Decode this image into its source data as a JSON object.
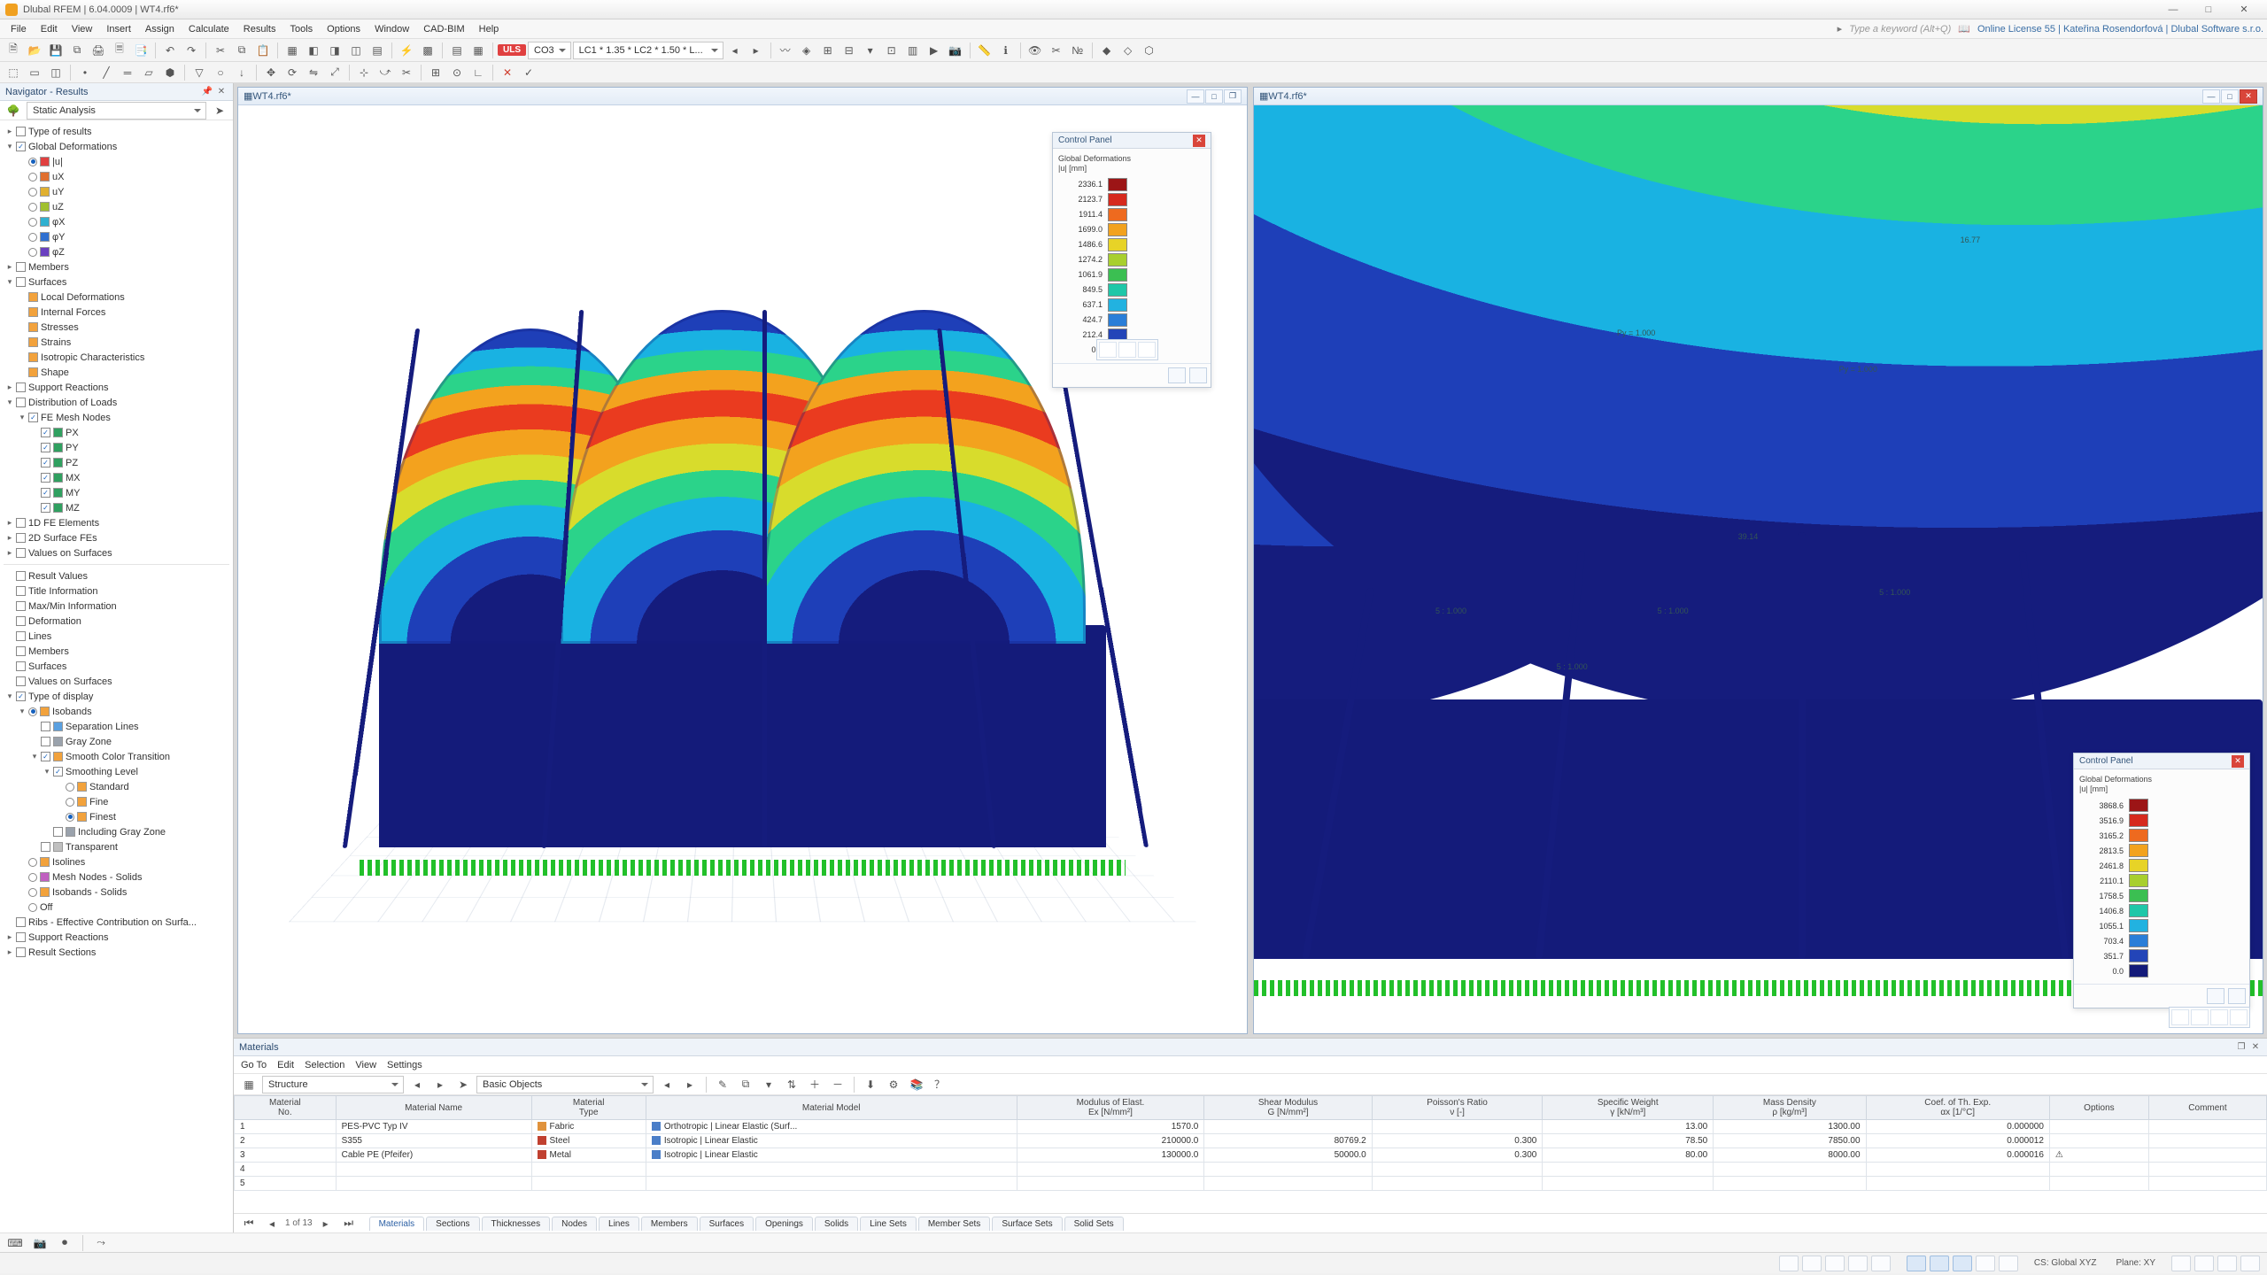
{
  "app": {
    "title": "Dlubal RFEM | 6.04.0009 | WT4.rf6*"
  },
  "window_buttons": {
    "min": "—",
    "max": "□",
    "close": "✕"
  },
  "menubar": {
    "items": [
      "File",
      "Edit",
      "View",
      "Insert",
      "Assign",
      "Calculate",
      "Results",
      "Tools",
      "Options",
      "Window",
      "CAD-BIM",
      "Help"
    ],
    "search_hint": "Type a keyword (Alt+Q)",
    "license": "Online License 55 | Kateřina Rosendorfová | Dlubal Software s.r.o."
  },
  "toolbar1": {
    "uls_label": "ULS",
    "co_label": "CO3",
    "lc_combo": "LC1 * 1.35 * LC2 * 1.50 * L..."
  },
  "navigator": {
    "title": "Navigator - Results",
    "static_combo": "Static Analysis",
    "tree1": [
      {
        "lvl": 0,
        "tw": "▸",
        "chk": false,
        "label": "Type of results"
      },
      {
        "lvl": 0,
        "tw": "▾",
        "chk": true,
        "label": "Global Deformations"
      },
      {
        "lvl": 1,
        "radio": true,
        "on": true,
        "color": "#e04040",
        "label": "|u|"
      },
      {
        "lvl": 1,
        "radio": true,
        "color": "#e07030",
        "label": "uX"
      },
      {
        "lvl": 1,
        "radio": true,
        "color": "#e0b030",
        "label": "uY"
      },
      {
        "lvl": 1,
        "radio": true,
        "color": "#a0c030",
        "label": "uZ"
      },
      {
        "lvl": 1,
        "radio": true,
        "color": "#30b0d0",
        "label": "φX"
      },
      {
        "lvl": 1,
        "radio": true,
        "color": "#3070d0",
        "label": "φY"
      },
      {
        "lvl": 1,
        "radio": true,
        "color": "#6a40c0",
        "label": "φZ"
      },
      {
        "lvl": 0,
        "tw": "▸",
        "chk": false,
        "label": "Members"
      },
      {
        "lvl": 0,
        "tw": "▾",
        "chk": false,
        "label": "Surfaces"
      },
      {
        "lvl": 1,
        "color": "#f2a23c",
        "label": "Local Deformations"
      },
      {
        "lvl": 1,
        "color": "#f2a23c",
        "label": "Internal Forces"
      },
      {
        "lvl": 1,
        "color": "#f2a23c",
        "label": "Stresses"
      },
      {
        "lvl": 1,
        "color": "#f2a23c",
        "label": "Strains"
      },
      {
        "lvl": 1,
        "color": "#f2a23c",
        "label": "Isotropic Characteristics"
      },
      {
        "lvl": 1,
        "color": "#f2a23c",
        "label": "Shape"
      },
      {
        "lvl": 0,
        "tw": "▸",
        "chk": false,
        "label": "Support Reactions"
      },
      {
        "lvl": 0,
        "tw": "▾",
        "chk": false,
        "label": "Distribution of Loads"
      },
      {
        "lvl": 1,
        "tw": "▾",
        "chk": true,
        "label": "FE Mesh Nodes"
      },
      {
        "lvl": 2,
        "chk": true,
        "color": "#30a060",
        "label": "PX"
      },
      {
        "lvl": 2,
        "chk": true,
        "color": "#30a060",
        "label": "PY"
      },
      {
        "lvl": 2,
        "chk": true,
        "color": "#30a060",
        "label": "PZ"
      },
      {
        "lvl": 2,
        "chk": true,
        "color": "#30a060",
        "label": "MX"
      },
      {
        "lvl": 2,
        "chk": true,
        "color": "#30a060",
        "label": "MY"
      },
      {
        "lvl": 2,
        "chk": true,
        "color": "#30a060",
        "label": "MZ"
      },
      {
        "lvl": 0,
        "tw": "▸",
        "chk": false,
        "label": "1D FE Elements"
      },
      {
        "lvl": 0,
        "tw": "▸",
        "chk": false,
        "label": "2D Surface FEs"
      },
      {
        "lvl": 0,
        "tw": "▸",
        "chk": false,
        "label": "Values on Surfaces"
      }
    ],
    "tree2": [
      {
        "lvl": 0,
        "chk": false,
        "label": "Result Values"
      },
      {
        "lvl": 0,
        "chk": false,
        "label": "Title Information"
      },
      {
        "lvl": 0,
        "chk": false,
        "label": "Max/Min Information"
      },
      {
        "lvl": 0,
        "chk": false,
        "label": "Deformation"
      },
      {
        "lvl": 0,
        "chk": false,
        "label": "Lines"
      },
      {
        "lvl": 0,
        "chk": false,
        "label": "Members"
      },
      {
        "lvl": 0,
        "chk": false,
        "label": "Surfaces"
      },
      {
        "lvl": 0,
        "chk": false,
        "label": "Values on Surfaces"
      },
      {
        "lvl": 0,
        "tw": "▾",
        "chk": true,
        "label": "Type of display"
      },
      {
        "lvl": 1,
        "tw": "▾",
        "radio": true,
        "on": true,
        "color": "#f2a23c",
        "label": "Isobands"
      },
      {
        "lvl": 2,
        "chk": false,
        "color": "#5aa0e0",
        "label": "Separation Lines"
      },
      {
        "lvl": 2,
        "chk": false,
        "color": "#9aa2ac",
        "label": "Gray Zone"
      },
      {
        "lvl": 2,
        "tw": "▾",
        "chk": true,
        "color": "#f2a23c",
        "label": "Smooth Color Transition"
      },
      {
        "lvl": 3,
        "tw": "▾",
        "chk": true,
        "label": "Smoothing Level"
      },
      {
        "lvl": 4,
        "radio": true,
        "color": "#f2a23c",
        "label": "Standard"
      },
      {
        "lvl": 4,
        "radio": true,
        "color": "#f2a23c",
        "label": "Fine"
      },
      {
        "lvl": 4,
        "radio": true,
        "on": true,
        "color": "#f2a23c",
        "label": "Finest"
      },
      {
        "lvl": 3,
        "chk": false,
        "color": "#9aa2ac",
        "label": "Including Gray Zone"
      },
      {
        "lvl": 2,
        "chk": false,
        "color": "#c0c0c0",
        "label": "Transparent"
      },
      {
        "lvl": 1,
        "radio": true,
        "color": "#f2a23c",
        "label": "Isolines"
      },
      {
        "lvl": 1,
        "radio": true,
        "color": "#c060c0",
        "label": "Mesh Nodes - Solids"
      },
      {
        "lvl": 1,
        "radio": true,
        "color": "#f2a23c",
        "label": "Isobands - Solids"
      },
      {
        "lvl": 1,
        "radio": true,
        "label": "Off"
      },
      {
        "lvl": 0,
        "chk": false,
        "label": "Ribs - Effective Contribution on Surfa..."
      },
      {
        "lvl": 0,
        "tw": "▸",
        "chk": false,
        "label": "Support Reactions"
      },
      {
        "lvl": 0,
        "tw": "▸",
        "chk": false,
        "label": "Result Sections"
      }
    ]
  },
  "viewports": {
    "left_title": "WT4.rf6*",
    "right_title": "WT4.rf6*",
    "annotations": [
      "5 : 1.000",
      "Py = 1.000",
      "39.14",
      "16.77"
    ]
  },
  "control_panel": {
    "title": "Control Panel",
    "subtitle": "Global Deformations\n|u| [mm]",
    "legend1": {
      "values": [
        "2336.1",
        "2123.7",
        "1911.4",
        "1699.0",
        "1486.6",
        "1274.2",
        "1061.9",
        "849.5",
        "637.1",
        "424.7",
        "212.4",
        "0.0"
      ],
      "colors": [
        "#9c1516",
        "#d62a1e",
        "#ee6a1f",
        "#f2a21e",
        "#e7d327",
        "#a8cf2e",
        "#3bbf52",
        "#1fc7a8",
        "#22b2e0",
        "#2a7ed8",
        "#2345b8",
        "#141b7a"
      ]
    },
    "legend2": {
      "values": [
        "3868.6",
        "3516.9",
        "3165.2",
        "2813.5",
        "2461.8",
        "2110.1",
        "1758.5",
        "1406.8",
        "1055.1",
        "703.4",
        "351.7",
        "0.0"
      ],
      "colors": [
        "#9c1516",
        "#d62a1e",
        "#ee6a1f",
        "#f2a21e",
        "#e7d327",
        "#a8cf2e",
        "#3bbf52",
        "#1fc7a8",
        "#22b2e0",
        "#2a7ed8",
        "#2345b8",
        "#141b7a"
      ]
    }
  },
  "materials": {
    "title": "Materials",
    "menu": [
      "Go To",
      "Edit",
      "Selection",
      "View",
      "Settings"
    ],
    "structure_combo": "Structure",
    "objects_combo": "Basic Objects",
    "headers": [
      "Material\nNo.",
      "Material Name",
      "Material\nType",
      "Material Model",
      "Modulus of Elast.\nEx [N/mm²]",
      "Shear Modulus\nG [N/mm²]",
      "Poisson's Ratio\nν [-]",
      "Specific Weight\nγ [kN/m³]",
      "Mass Density\nρ [kg/m³]",
      "Coef. of Th. Exp.\nαx [1/°C]",
      "Options",
      "Comment"
    ],
    "rows": [
      {
        "no": "1",
        "name": "PES-PVC Typ IV",
        "type": "Fabric",
        "tcolor": "#e0923c",
        "model": "Orthotropic | Linear Elastic (Surf...",
        "mcolor": "#4a7ec8",
        "E": "1570.0",
        "G": "",
        "nu": "",
        "gamma": "13.00",
        "rho": "1300.00",
        "alpha": "0.000000",
        "opt": ""
      },
      {
        "no": "2",
        "name": "S355",
        "type": "Steel",
        "tcolor": "#c04030",
        "model": "Isotropic | Linear Elastic",
        "mcolor": "#4a7ec8",
        "E": "210000.0",
        "G": "80769.2",
        "nu": "0.300",
        "gamma": "78.50",
        "rho": "7850.00",
        "alpha": "0.000012",
        "opt": ""
      },
      {
        "no": "3",
        "name": "Cable PE (Pfeifer)",
        "type": "Metal",
        "tcolor": "#c04030",
        "model": "Isotropic | Linear Elastic",
        "mcolor": "#4a7ec8",
        "E": "130000.0",
        "G": "50000.0",
        "nu": "0.300",
        "gamma": "80.00",
        "rho": "8000.00",
        "alpha": "0.000016",
        "opt": "⚠"
      },
      {
        "no": "4"
      },
      {
        "no": "5"
      }
    ],
    "pager": "1 of 13",
    "tabs": [
      "Materials",
      "Sections",
      "Thicknesses",
      "Nodes",
      "Lines",
      "Members",
      "Surfaces",
      "Openings",
      "Solids",
      "Line Sets",
      "Member Sets",
      "Surface Sets",
      "Solid Sets"
    ],
    "active_tab": "Materials"
  },
  "statusbar": {
    "cs": "CS: Global XYZ",
    "plane": "Plane: XY"
  }
}
